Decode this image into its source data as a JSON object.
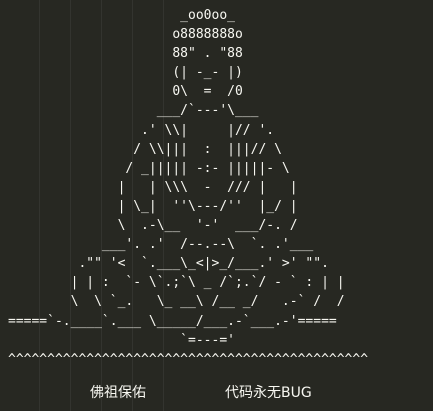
{
  "lines": [
    "                      _oo0oo_",
    "                     o8888888o",
    "                     88\" . \"88",
    "                     (| -_- |)",
    "                     0\\  =  /0",
    "                   ___/`---'\\___",
    "                 .' \\\\|     |// '.",
    "                / \\\\|||  :  |||// \\",
    "               / _||||| -:- |||||- \\",
    "              |   | \\\\\\  -  /// |   |",
    "              | \\_|  ''\\---/''  |_/ |",
    "              \\  .-\\__  '-'  ___/-. /",
    "            ___'. .'  /--.--\\  `. .'___",
    "         .\"\" '<  `.___\\_<|>_/___.' >' \"\".",
    "        | | :  `- \\`.;`\\ _ /`;.`/ - ` : | |",
    "        \\  \\ `_.   \\_ __\\ /__ _/   .-` /  /",
    "=====`-.____`.___ \\_____/___.-`___.-'=====",
    "                      `=---='",
    "^^^^^^^^^^^^^^^^^^^^^^^^^^^^^^^^^^^^^^^^^^^^^^"
  ],
  "footer": {
    "left_text": "佛祖保佑",
    "right_text": "代码永无BUG"
  },
  "colors": {
    "background": "#272822",
    "foreground": "#f8f8f2"
  }
}
